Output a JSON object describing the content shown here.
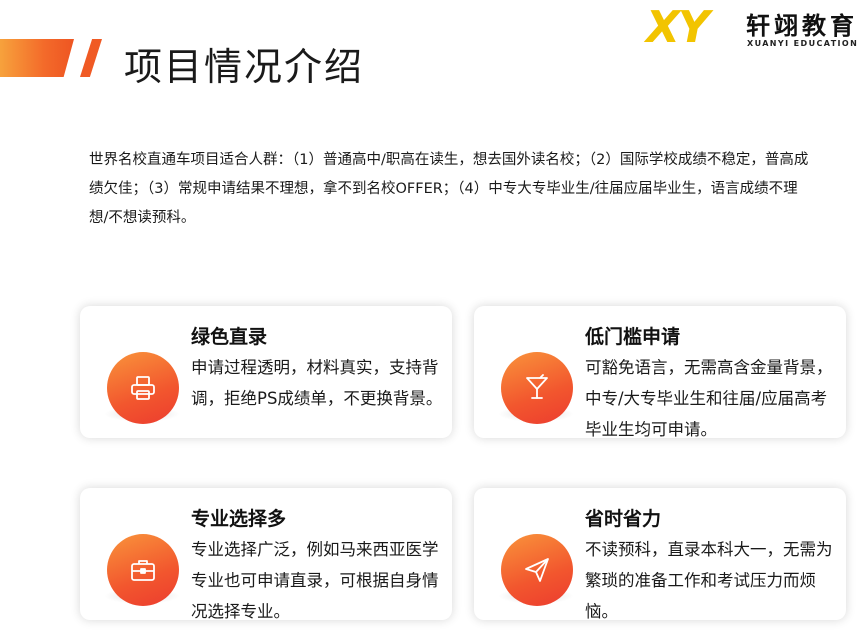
{
  "header": {
    "title": "项目情况介绍",
    "logo_mark": "XY",
    "logo_cn": "轩翊教育",
    "logo_en": "XUANYI EDUCATION"
  },
  "intro": "世界名校直通车项目适合人群：（1）普通高中/职高在读生，想去国外读名校；（2）国际学校成绩不稳定，普高成绩欠佳；（3）常规申请结果不理想，拿不到名校OFFER；（4）中专大专毕业生/往届应届毕业生，语言成绩不理想/不想读预科。",
  "cards": [
    {
      "title": "绿色直录",
      "text": "申请过程透明，材料真实，支持背调，拒绝PS成绩单，不更换背景。",
      "icon": "printer-icon"
    },
    {
      "title": "低门槛申请",
      "text": "可豁免语言，无需高含金量背景，中专/大专毕业生和往届/应届高考毕业生均可申请。",
      "icon": "cocktail-glass-icon"
    },
    {
      "title": "专业选择多",
      "text": "专业选择广泛，例如马来西亚医学专业也可申请直录，可根据自身情况选择专业。",
      "icon": "briefcase-icon"
    },
    {
      "title": "省时省力",
      "text": "不读预科，直录本科大一，无需为繁琐的准备工作和考试压力而烦恼。",
      "icon": "paper-plane-icon"
    }
  ],
  "colors": {
    "accent": "#f05a24",
    "icon_gradient_start": "#f9943b",
    "icon_gradient_end": "#ec3c2f",
    "logo_yellow": "#f2c400"
  }
}
